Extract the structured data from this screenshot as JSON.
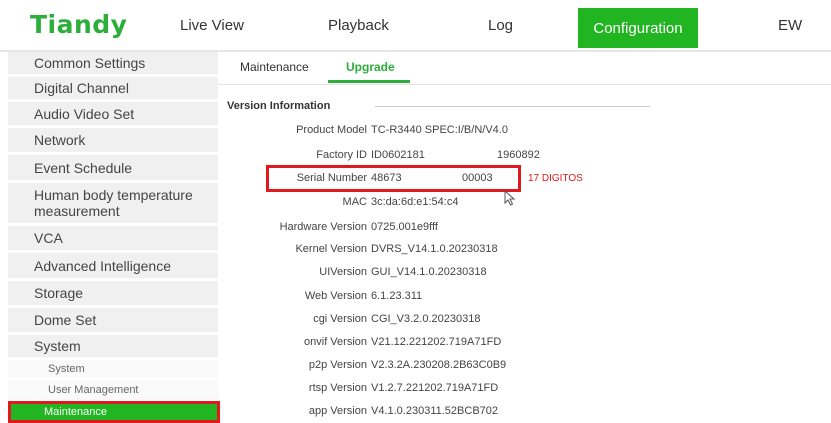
{
  "brand": {
    "logo": "Tiandy"
  },
  "nav": {
    "live_view": "Live View",
    "playback": "Playback",
    "log": "Log",
    "configuration": "Configuration",
    "ew": "EW"
  },
  "sidebar": {
    "common_settings": "Common Settings",
    "digital_channel": "Digital Channel",
    "audio_video_set": "Audio Video Set",
    "network": "Network",
    "event_schedule": "Event Schedule",
    "human_body_line1": "Human body temperature",
    "human_body_line2": "measurement",
    "vca": "VCA",
    "advanced_intelligence": "Advanced Intelligence",
    "storage": "Storage",
    "dome_set": "Dome Set",
    "system": "System",
    "sub_system": "System",
    "sub_user_management": "User Management",
    "sub_maintenance": "Maintenance"
  },
  "tabs": {
    "maintenance": "Maintenance",
    "upgrade": "Upgrade"
  },
  "version_info": {
    "title": "Version Information",
    "product_model_label": "Product Model",
    "product_model": "TC-R3440 SPEC:I/B/N/V4.0",
    "factory_id_label": "Factory ID",
    "factory_id": "ID0602181",
    "factory_id_suffix": "1960892",
    "serial_number_label": "Serial Number",
    "serial_number_part1": "48673",
    "serial_number_part2": "00003",
    "serial_note": "17 DIGITOS",
    "mac_label": "MAC",
    "mac": "3c:da:6d:e1:54:c4",
    "hardware_label": "Hardware Version",
    "hardware": "0725.001e9fff",
    "kernel_label": "Kernel Version",
    "kernel": "DVRS_V14.1.0.20230318",
    "ui_label": "UIVersion",
    "ui": "GUI_V14.1.0.20230318",
    "web_label": "Web Version",
    "web": "6.1.23.311",
    "cgi_label": "cgi Version",
    "cgi": "CGI_V3.2.0.20230318",
    "onvif_label": "onvif Version",
    "onvif": "V21.12.221202.719A71FD",
    "p2p_label": "p2p Version",
    "p2p": "V2.3.2A.230208.2B63C0B9",
    "rtsp_label": "rtsp Version",
    "rtsp": "V1.2.7.221202.719A71FD",
    "app_label": "app Version",
    "app": "V4.1.0.230311.52BCB702"
  },
  "colors": {
    "brand_green": "#22b522",
    "highlight_red": "#e0191e"
  },
  "icons": {
    "cursor": "mouse-pointer-icon"
  }
}
